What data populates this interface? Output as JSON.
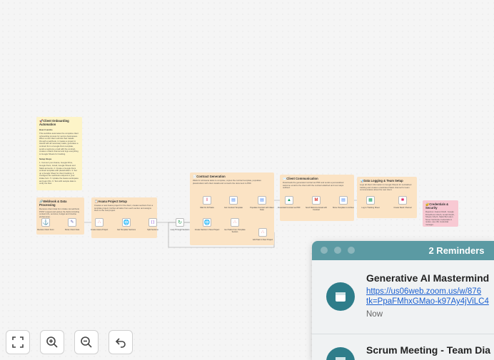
{
  "canvas": {
    "notes": {
      "overview": {
        "title": "🚀Client Onboarding Automation",
        "how_title": "How it works",
        "how_body": "This workflow automates the complete client onboarding process for service businesses. When a new client submits their details through a webhook, it creates a project in Asana with all necessary tasks, generates a contract from a Google Docs template, sends a welcome email with the contract, creates a Slack channel and logs everything to Google Sheets for tracking.",
        "setup_title": "Setup Steps",
        "setup_body": "1. Connect your Asana, Google Drive, Google Docs, Gmail, Google Sheets and Slack accounts. 2. Create a Google Docs contract template with placeholders. 3. Set up a Google Sheet for client tracking. 4. Configure the webhook endpoint in your intake form. 5. Update the Asana workspace and team IDs. 6. Test with sample data to verify the flow."
      },
      "webhook": {
        "title": "🔗Webhook & Data Processing",
        "body": "Receives client data from intake via webhook POST request and parses the fields including contact info, services, budget and timeline preferences."
      },
      "asana": {
        "title": "📋Asana Project Setup",
        "body": "Creates a new Asana project for the client, creates sections from a template project, fetches all tasks from each section and assigns them to the new project."
      },
      "contract": {
        "title": "📄Contract Generation",
        "body": "Waits for all Asana tasks to complete, copies the contract template, populates placeholders with client details and converts the document to PDF."
      },
      "comms": {
        "title": "✉️Client Communication",
        "body": "Downloads the generated contract as PDF and sends a personalized welcome email to the client with the contract attached and next steps outlined."
      },
      "logging": {
        "title": "📊Data Logging & Team Setup",
        "body": "Logs all client information to Google Sheets for centralized tracking and creates a dedicated Slack channel for team communication about the new client."
      },
      "creds": {
        "title": "🔐Credentials & Security",
        "body": "Requires: Asana OAuth, Google Drive/Docs OAuth, Gmail OAuth, Sheets OAuth, Slack Bot token. Never hardcode credentials in nodes; use n8n credential manager."
      }
    },
    "nodes": {
      "receive_client": "Receive Client Form",
      "parse_client": "Parse Client Data",
      "create_asana_project": "Create Asana Project",
      "get_template_sections": "Get Template Sections",
      "split_sections": "Split Sections",
      "loop_sections": "Loop Through Sections",
      "wait_tasks": "Wait for All Tasks",
      "get_contract_template": "Get Contract Template",
      "populate_contract": "Populate Contract with Client Data",
      "create_section": "Create Section in New Project",
      "get_tasks": "Get Tasks From Template Section",
      "add_task": "Add Task to New Project",
      "download_contract": "Download Contract as PDF",
      "send_welcome": "Send Welcome Email with Contract",
      "move_template": "Move Template to Archive",
      "log_tracking": "Log to Tracking Sheet",
      "create_slack": "Create Slack Channel"
    }
  },
  "controls": {
    "fit": "fit-view",
    "zoom_in": "zoom-in",
    "zoom_out": "zoom-out",
    "undo": "undo"
  },
  "reminders": {
    "title": "2 Reminders",
    "items": [
      {
        "name": "Generative AI Mastermind",
        "link1": "https://us06web.zoom.us/w/876",
        "link2": "tk=PpaFMhxGMao-k97Ay4jViLC4",
        "time": "Now"
      },
      {
        "name": "Scrum Meeting - Team Dia"
      }
    ]
  },
  "colors": {
    "accent": "#5b9aa3",
    "icon_bg": "#2e7d8a",
    "link": "#1a5fd0"
  }
}
